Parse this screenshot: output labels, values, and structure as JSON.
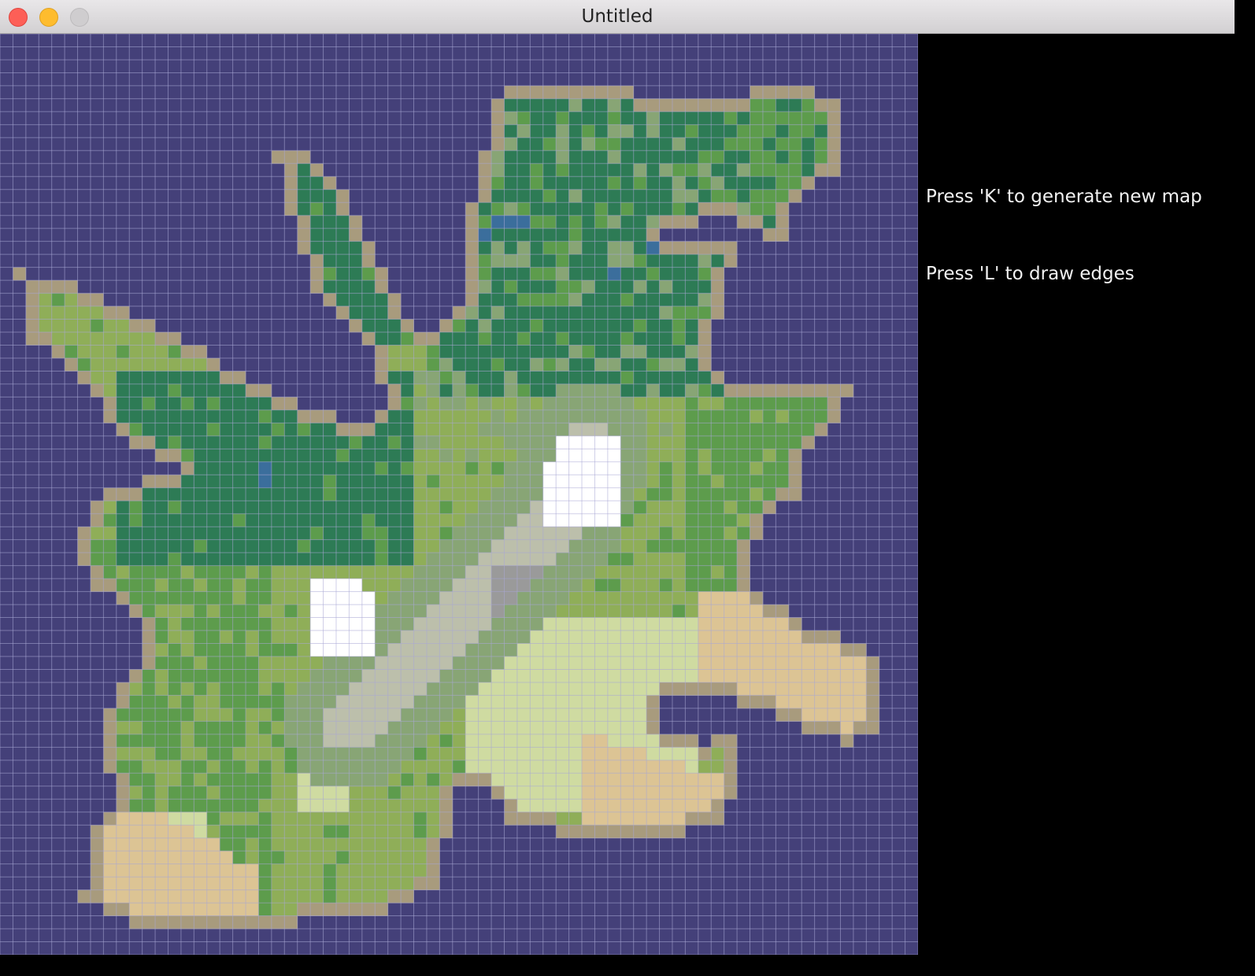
{
  "window": {
    "title": "Untitled",
    "buttons": [
      "close",
      "minimize",
      "zoom"
    ]
  },
  "instructions": [
    "Press 'K' to generate new map",
    "Press 'L' to draw edges"
  ],
  "map": {
    "grid": {
      "cols": 71,
      "rows": 71,
      "visible_rows": 71,
      "lines_on": true
    },
    "gridline_color": "#a9a7d6",
    "palette": {
      "ocean": "#444079",
      "beach": "#a89b7d",
      "sand": "#dcc494",
      "grass": "#8fae58",
      "light_grass": "#5d9c4c",
      "forest": "#2d7b55",
      "rainforest": "#357e5a",
      "plains": "#cfdba1",
      "shrub": "#88a575",
      "rock": "#bcbfab",
      "dark_rock": "#9a9a9a",
      "snow": "#ffffff",
      "lake": "#3b6e9c"
    }
  }
}
